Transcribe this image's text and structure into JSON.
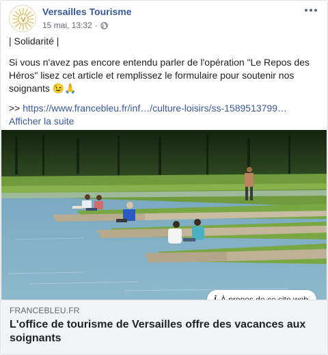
{
  "page": {
    "author": "Versailles Tourisme",
    "date": "15 mai, 13:32",
    "separator": "·",
    "privacy_icon": "globe-icon",
    "more_icon": "three-dots-icon"
  },
  "post": {
    "line1": "| Solidarité |",
    "line2": "Si vous n'avez pas encore entendu parler de l'opération \"Le Repos des Héros\" lisez cet article et remplissez le formulaire pour soutenir nos soignants 😉🙏",
    "link_prefix": ">>",
    "link_text": "https://www.francebleu.fr/inf…/culture-loisirs/ss-1589513799…",
    "see_more": "Afficher la suite"
  },
  "link_preview": {
    "about_label": "À propos de ce site web",
    "about_icon": "info-icon",
    "domain": "FRANCEBLEU.FR",
    "title": "L'office de tourisme de Versailles offre des vacances aux soignants"
  },
  "colors": {
    "link_blue": "#385898",
    "meta_gray": "#616770",
    "preview_bg": "#f2f3f5"
  }
}
